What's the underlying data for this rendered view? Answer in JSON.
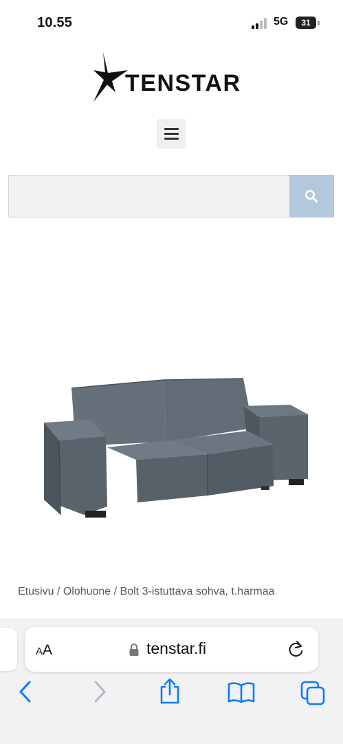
{
  "status_bar": {
    "time": "10.55",
    "network": "5G",
    "battery": "31"
  },
  "logo": {
    "text": "TENSTAR"
  },
  "search": {
    "placeholder": ""
  },
  "breadcrumb": {
    "items": [
      "Etusivu",
      "Olohuone",
      "Bolt 3-istuttava sohva, t.harmaa"
    ],
    "separator": " / "
  },
  "browser": {
    "reader_label_small": "A",
    "reader_label_large": "A",
    "url": "tenstar.fi"
  },
  "colors": {
    "accent": "#b3c8db",
    "ios_blue": "#0a7aff",
    "sofa": "#5f6a74"
  },
  "icons": [
    "menu-icon",
    "search-icon",
    "lock-icon",
    "reload-icon",
    "back-icon",
    "forward-icon",
    "share-icon",
    "bookmarks-icon",
    "tabs-icon"
  ]
}
